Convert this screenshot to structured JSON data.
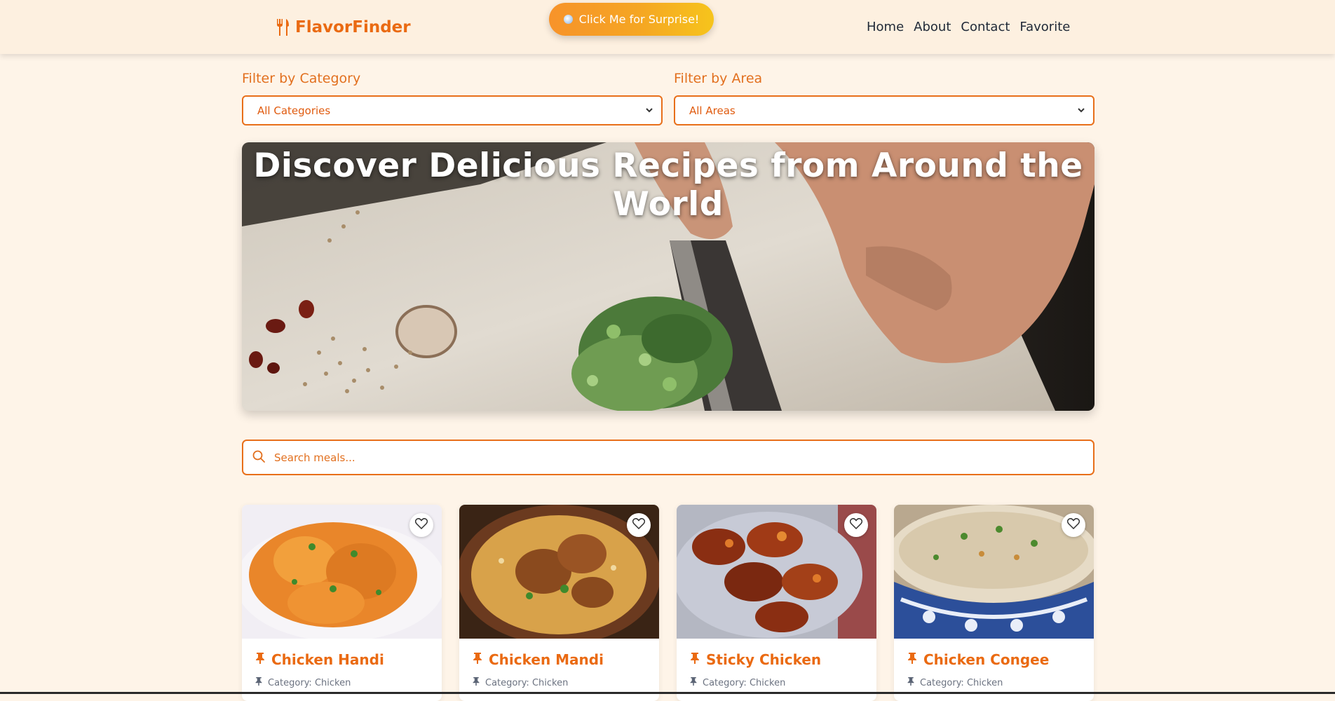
{
  "header": {
    "logo_text": "FlavorFinder",
    "logo_icon": "utensils-icon",
    "surprise_label": "Click Me for Surprise!",
    "nav": [
      "Home",
      "About",
      "Contact",
      "Favorite"
    ]
  },
  "filters": {
    "category_label": "Filter by Category",
    "category_value": "All Categories",
    "area_label": "Filter by Area",
    "area_value": "All Areas"
  },
  "hero": {
    "title": "Discover Delicious Recipes from Around the World"
  },
  "search": {
    "placeholder": "Search meals..."
  },
  "meals": [
    {
      "name": "Chicken Handi",
      "category": "Category: Chicken"
    },
    {
      "name": "Chicken Mandi",
      "category": "Category: Chicken"
    },
    {
      "name": "Sticky Chicken",
      "category": "Category: Chicken"
    },
    {
      "name": "Chicken Congee",
      "category": "Category: Chicken"
    }
  ],
  "colors": {
    "accent": "#ea6a12",
    "background": "#fef4e8",
    "header": "#fdf0e0"
  }
}
